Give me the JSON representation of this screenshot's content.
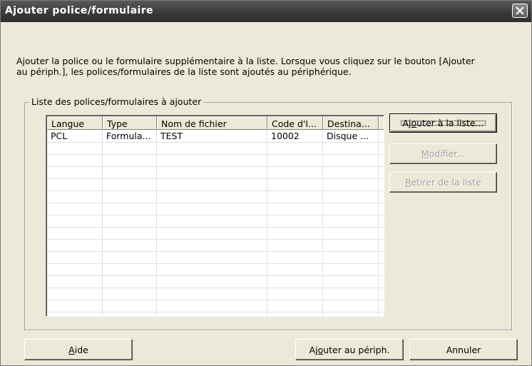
{
  "window": {
    "title": "Ajouter police/formulaire"
  },
  "description": {
    "line1": "Ajouter la police ou le formulaire supplémentaire à la liste. Lorsque vous cliquez sur le bouton [Ajouter",
    "line2": "au périph.], les polices/formulaires de la liste sont ajoutés au périphérique."
  },
  "group": {
    "label": "Liste des polices/formulaires à ajouter"
  },
  "list": {
    "columns": [
      "Langue",
      "Type",
      "Nom de fichier",
      "Code d'I...",
      "Destina..."
    ],
    "rows": [
      [
        "PCL",
        "Formula...",
        "TEST",
        "10002",
        "Disque ..."
      ]
    ]
  },
  "side_buttons": {
    "add_prefix": "Aj",
    "add_mnemonic": "o",
    "add_suffix": "uter à la liste...",
    "modify_mnemonic": "M",
    "modify_suffix": "odifier...",
    "remove_mnemonic": "R",
    "remove_suffix": "etirer de la liste"
  },
  "bottom_buttons": {
    "help_mnemonic": "A",
    "help_suffix": "ide",
    "add_device_prefix": "Aj",
    "add_device_mnemonic": "o",
    "add_device_suffix": "uter au périph.",
    "cancel": "Annuler"
  },
  "colors": {
    "titlebar": "#383838",
    "dialog_bg": "#ece9d8",
    "disabled_text": "#a0a0a0"
  }
}
